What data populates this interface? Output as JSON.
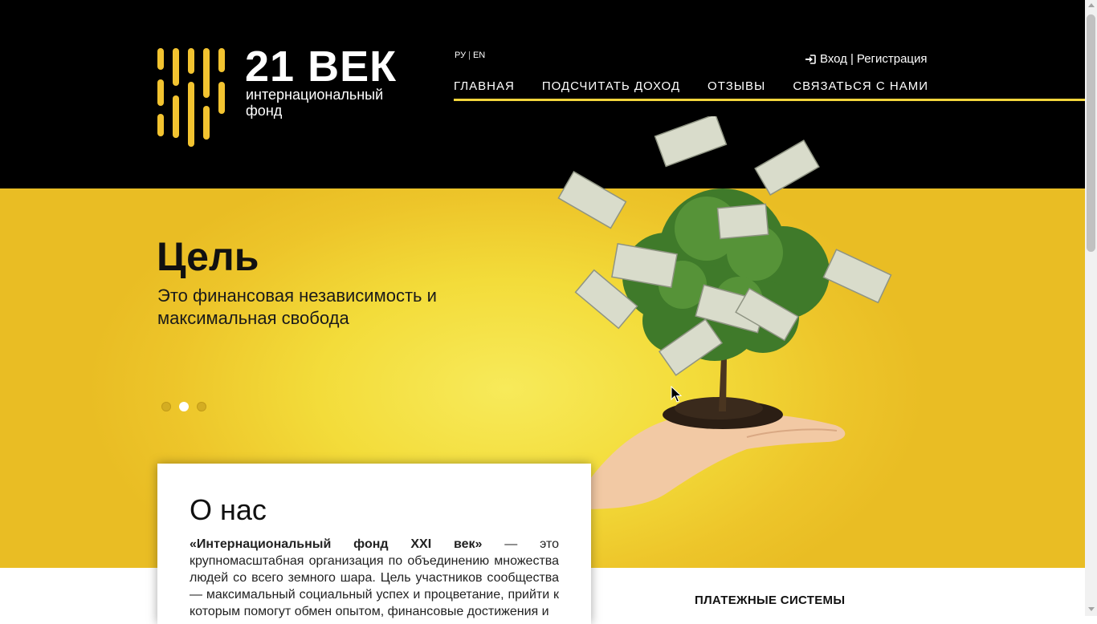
{
  "logo": {
    "title": "21 ВЕК",
    "subtitle_line1": "интернациональный",
    "subtitle_line2": "фонд"
  },
  "language": {
    "ru": "РУ",
    "separator": "|",
    "en": "EN"
  },
  "auth": {
    "icon": "sign-in-icon",
    "login": "Вход",
    "separator": "|",
    "register": "Регистрация"
  },
  "nav": {
    "items": [
      {
        "label": "ГЛАВНАЯ"
      },
      {
        "label": "ПОДСЧИТАТЬ ДОХОД"
      },
      {
        "label": "ОТЗЫВЫ"
      },
      {
        "label": "СВЯЗАТЬСЯ С НАМИ"
      }
    ],
    "accent_color": "#f2d53c"
  },
  "hero": {
    "title": "Цель",
    "text": "Это финансовая независимость и максимальная свобода",
    "slides_count": 3,
    "active_slide": 2,
    "illustration": "money-tree-on-hand"
  },
  "about": {
    "title": "О нас",
    "text_bold": "«Интернациональный фонд XXI век»",
    "text_rest": " — это крупномасштабная организация по объединению множества людей со всего земного шара. Цель участников сообщества — максимальный социальный успех и процветание, прийти к которым помогут обмен опытом, финансовые достижения и"
  },
  "payment": {
    "title": "ПЛАТЕЖНЫЕ СИСТЕМЫ"
  },
  "colors": {
    "header_bg": "#000000",
    "hero_yellow": "#f3dc3a",
    "accent": "#f2d53c"
  }
}
